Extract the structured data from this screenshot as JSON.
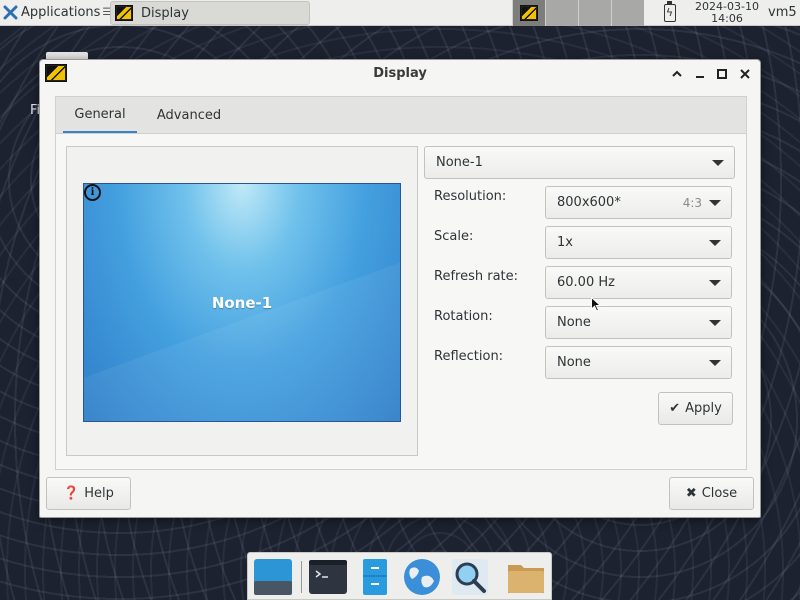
{
  "top_panel": {
    "applications_label": "Applications",
    "task_title": "Display",
    "clock_date": "2024-03-10",
    "clock_time": "14:06",
    "user": "vm5"
  },
  "desktop": {
    "partial_text": "Fi"
  },
  "window": {
    "title": "Display",
    "tabs": [
      {
        "label": "General",
        "active": true
      },
      {
        "label": "Advanced",
        "active": false
      }
    ],
    "preview": {
      "monitor_name": "None-1"
    },
    "output_select": "None-1",
    "fields": {
      "resolution": {
        "label": "Resolution:",
        "value": "800x600*",
        "hint": "4:3"
      },
      "scale": {
        "label": "Scale:",
        "value": "1x"
      },
      "refresh_rate": {
        "label": "Refresh rate:",
        "value": "60.00 Hz"
      },
      "rotation": {
        "label": "Rotation:",
        "value": "None"
      },
      "reflection": {
        "label": "Reflection:",
        "value": "None"
      }
    },
    "apply_label": "Apply",
    "help_label": "Help",
    "close_label": "Close"
  },
  "colors": {
    "accent": "#3b81c9",
    "monitor_blue": "#44a0df"
  },
  "icons": [
    "xfce-mouse-icon",
    "display-app-icon",
    "battery-charging-icon",
    "minimize-icon",
    "maximize-icon",
    "close-icon",
    "info-icon",
    "check-icon",
    "help-icon",
    "close-x-icon",
    "desktop-icon",
    "terminal-icon",
    "file-manager-icon",
    "web-browser-icon",
    "search-icon",
    "folder-icon"
  ]
}
